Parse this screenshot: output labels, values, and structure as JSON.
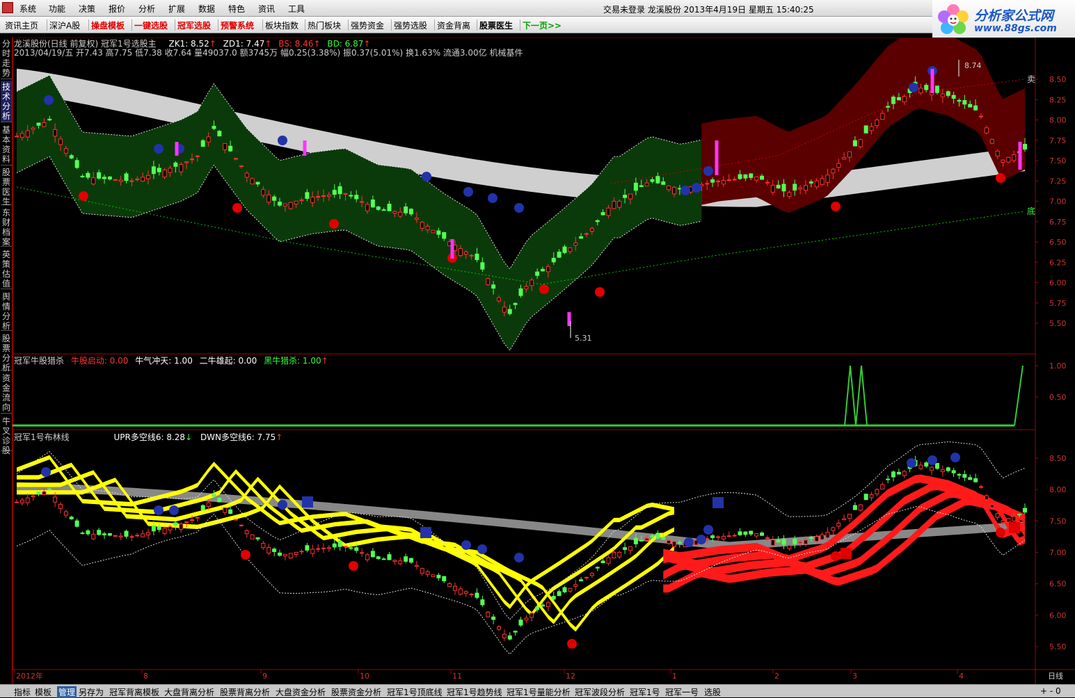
{
  "menu": {
    "items": [
      "系统",
      "功能",
      "决策",
      "报价",
      "分析",
      "扩展",
      "数据",
      "特色",
      "资讯",
      "工具"
    ],
    "status": "交易未登录  龙溪股份  2013年4月19日  星期五  15:40:25"
  },
  "toolbar": {
    "items": [
      {
        "label": "资讯主页",
        "style": "normal"
      },
      {
        "label": "深沪A股",
        "style": "normal"
      },
      {
        "label": "操盘模板",
        "style": "red"
      },
      {
        "label": "一键选股",
        "style": "red"
      },
      {
        "label": "冠军选股",
        "style": "red"
      },
      {
        "label": "预警系统",
        "style": "red"
      },
      {
        "label": "板块指数",
        "style": "normal"
      },
      {
        "label": "热门板块",
        "style": "normal"
      },
      {
        "label": "强势资金",
        "style": "normal"
      },
      {
        "label": "强势选股",
        "style": "normal"
      },
      {
        "label": "资金背离",
        "style": "normal"
      },
      {
        "label": "股票医生",
        "style": "bold"
      },
      {
        "label": "下一页>>",
        "style": "green"
      }
    ]
  },
  "brand": {
    "name": "分析家公式网",
    "url": "www.88gs.com"
  },
  "sidebar": {
    "tabs": [
      "分时走势",
      "技术分析",
      "基本资料",
      "股票医生",
      "东财档案",
      "英策估值",
      "舆情分析",
      "股票分析",
      "资金流向",
      "牛叉诊股"
    ],
    "active": 1
  },
  "main_panel": {
    "title": "龙溪股份(日线 前复权) 冠军1号选股主",
    "zk1": "ZK1: 8.52",
    "zd1": "ZD1: 7.47",
    "bs": "BS: 8.46",
    "bd": "BD: 6.87",
    "quote": "2013/04/19/五  开7.43 高7.75 低7.38 收7.64 量49037.0 额3745万 幅0.25(3.38%) 振0.37(5.01%) 换1.63% 流通3.00亿 机械基件",
    "high_label": "8.74",
    "low_label": "5.31",
    "axis_ticks": [
      "8.50",
      "8.25",
      "8.00",
      "7.75",
      "7.50",
      "7.25",
      "7.00",
      "6.75",
      "6.50",
      "6.25",
      "6.00",
      "5.75",
      "5.50"
    ],
    "right_labels": {
      "top": "卖",
      "bottom": "底"
    }
  },
  "mid_panel": {
    "title": "冠军牛股猎杀",
    "f1": "牛股启动: 0.00",
    "f2": "牛气冲天: 1.00",
    "f3": "二牛雄起: 0.00",
    "f4": "黑牛猎杀: 1.00",
    "axis_ticks": [
      "1.00",
      "0.50"
    ]
  },
  "lower_panel": {
    "title": "冠军1号布林线",
    "upr": "UPR多空线6: 8.28",
    "dwn": "DWN多空线6: 7.75",
    "axis_ticks": [
      "8.50",
      "8.00",
      "7.50",
      "7.00",
      "6.50",
      "6.00",
      "5.50"
    ]
  },
  "time_axis": {
    "labels": [
      "2012年",
      "8",
      "9",
      "10",
      "11",
      "12",
      "1",
      "2",
      "3",
      "4"
    ],
    "period": "日线"
  },
  "bottom_tabs": {
    "items": [
      "指标",
      "模板",
      "管理",
      "另存为",
      "冠军背离模板",
      "大盘背离分析",
      "股票背离分析",
      "大盘资金分析",
      "股票资金分析",
      "冠军1号顶底线",
      "冠军1号趋势线",
      "冠军1号量能分析",
      "冠军波段分析",
      "冠军1号",
      "冠军一号",
      "选股"
    ],
    "active": 2,
    "pager": "+  -  0"
  },
  "colors": {
    "up": "#ff3333",
    "down": "#55ff55",
    "green_band": "#0a3a0a",
    "red_band": "#5a0000",
    "gray_band": "#cfcfcf",
    "yellow_ribbon": "#ffff00",
    "red_ribbon": "#ff1a1a",
    "buy_marker": "#e00000",
    "sell_marker": "#2233aa",
    "magenta": "#ff33ff"
  }
}
